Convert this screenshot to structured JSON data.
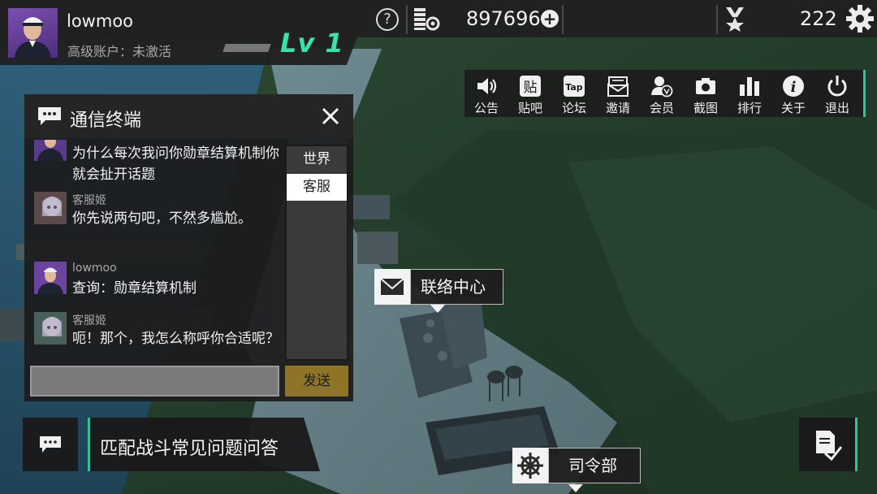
{
  "player": {
    "username": "lowmoo",
    "account_status": "高级账户：未激活",
    "level": "Lv 1"
  },
  "resources": {
    "help": "?",
    "coins": "897696",
    "add": "+",
    "medals": "222"
  },
  "menu": [
    {
      "label": "公告",
      "icon": "speaker-icon"
    },
    {
      "label": "贴吧",
      "icon": "tieba-icon"
    },
    {
      "label": "论坛",
      "icon": "tap-icon"
    },
    {
      "label": "邀请",
      "icon": "invite-icon"
    },
    {
      "label": "会员",
      "icon": "member-icon"
    },
    {
      "label": "截图",
      "icon": "camera-icon"
    },
    {
      "label": "排行",
      "icon": "ranking-icon"
    },
    {
      "label": "关于",
      "icon": "info-icon"
    },
    {
      "label": "退出",
      "icon": "power-icon"
    }
  ],
  "menu_glyphs": {
    "tieba": "贴",
    "tap": "Tap",
    "info": "i"
  },
  "chat": {
    "title": "通信终端",
    "messages": [
      {
        "name": "",
        "text": "为什么每次我问你勋章结算机制你就会扯开话题"
      },
      {
        "name": "客服姬",
        "text": "你先说两句吧，不然多尴尬。"
      },
      {
        "name": "lowmoo",
        "text": "查询：勋章结算机制"
      },
      {
        "name": "客服姬",
        "text": "呃！那个，我怎么称呼你合适呢？"
      }
    ],
    "channels": [
      {
        "label": "世界",
        "active": false
      },
      {
        "label": "客服",
        "active": true
      }
    ],
    "input_value": "",
    "send_label": "发送"
  },
  "faq": {
    "label": "匹配战斗常见问题问答"
  },
  "map_labels": {
    "contact_center": "联络中心",
    "headquarters": "司令部"
  },
  "colors": {
    "accent": "#2fc49a",
    "level": "#37e3a6",
    "send": "#8f7428"
  }
}
